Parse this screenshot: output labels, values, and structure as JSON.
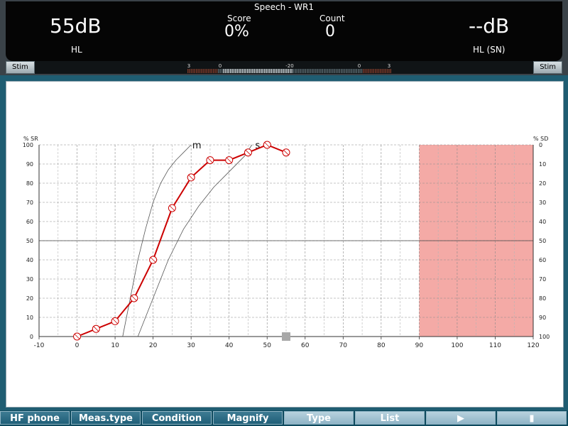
{
  "header": {
    "title": "Speech - WR1",
    "left_level": "55dB",
    "left_unit": "HL",
    "right_level": "--dB",
    "right_unit": "HL (SN)",
    "score_label": "Score",
    "score_value": "0%",
    "count_label": "Count",
    "count_value": "0"
  },
  "stim": {
    "left_label": "Stim",
    "right_label": "Stim"
  },
  "vu_meter": {
    "labels": [
      "3",
      "0",
      "-20",
      "0",
      "3"
    ]
  },
  "chart_data": {
    "type": "line",
    "y_left_label": "% SR",
    "y_right_label": "% SD",
    "x_ticks": [
      -10,
      0,
      10,
      20,
      30,
      40,
      50,
      60,
      70,
      80,
      90,
      100,
      110,
      120
    ],
    "y_left_ticks": [
      0,
      10,
      20,
      30,
      40,
      50,
      60,
      70,
      80,
      90,
      100
    ],
    "y_right_ticks": [
      100,
      90,
      80,
      70,
      60,
      50,
      40,
      30,
      20,
      10,
      0
    ],
    "xlim": [
      -10,
      120
    ],
    "ylim": [
      0,
      100
    ],
    "grid": true,
    "series": [
      {
        "color": "#cc0000",
        "x": [
          0,
          5,
          10,
          15,
          20,
          25,
          30,
          35,
          40,
          45,
          50,
          55
        ],
        "y": [
          0,
          4,
          8,
          20,
          40,
          67,
          83,
          92,
          92,
          96,
          100,
          96
        ]
      }
    ],
    "reference_curves": [
      {
        "label": "m",
        "x": [
          12,
          14,
          16,
          18,
          20,
          22,
          24,
          26,
          28,
          30
        ],
        "y": [
          0,
          20,
          40,
          56,
          70,
          80,
          87,
          92,
          96,
          100
        ]
      },
      {
        "label": "s",
        "x": [
          16,
          20,
          24,
          28,
          32,
          36,
          40,
          44,
          46
        ],
        "y": [
          0,
          20,
          40,
          56,
          68,
          78,
          86,
          94,
          100
        ]
      }
    ],
    "masking_region": {
      "x_from": 90,
      "x_to": 120,
      "y_from": 0,
      "y_to": 100,
      "color": "#f4aaa6"
    },
    "level_marker": {
      "x": 55,
      "y": 0
    },
    "reference_line_y": 50
  },
  "function_keys": [
    {
      "label": "HF phone",
      "style": "dark"
    },
    {
      "label": "Meas.type",
      "style": "dark"
    },
    {
      "label": "Condition",
      "style": "dark"
    },
    {
      "label": "Magnify",
      "style": "dark"
    },
    {
      "label": "Type",
      "style": "light"
    },
    {
      "label": "List",
      "style": "light"
    },
    {
      "label": "▶",
      "style": "light"
    },
    {
      "label": "▮",
      "style": "light"
    }
  ]
}
